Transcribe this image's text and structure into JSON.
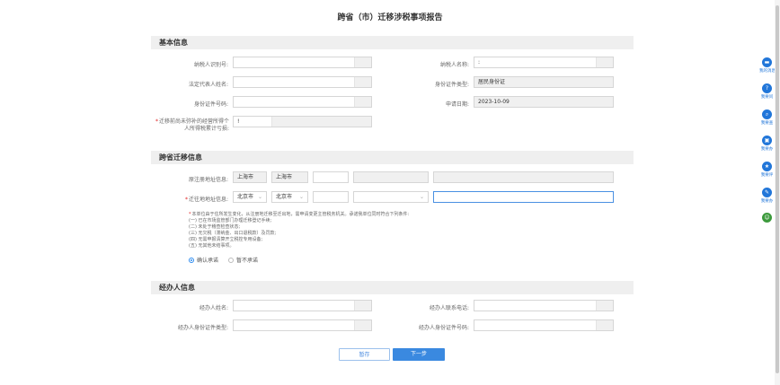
{
  "page_title": "跨省（市）迁移涉税事项报告",
  "sections": {
    "basic": "基本信息",
    "migration": "跨省迁移信息",
    "handler": "经办人信息"
  },
  "basic": {
    "taxpayer_id_label": "纳税人识别号:",
    "taxpayer_id_value": "",
    "taxpayer_name_label": "纳税人名称:",
    "taxpayer_name_value": ":",
    "legal_rep_label": "法定代表人姓名:",
    "legal_rep_value": "",
    "id_type_label": "身份证件类型:",
    "id_type_value": "居民身份证",
    "id_no_label": "身份证件号码:",
    "id_no_value": "",
    "apply_date_label": "申请日期:",
    "apply_date_value": "2023-10-09",
    "income_label_1": "迁移前尚未弥补的经营所得个",
    "income_label_2": "人所得税累计亏损:",
    "income_value": "!"
  },
  "migration": {
    "orig_label": "原注册地址信息:",
    "orig_province": "上海市",
    "orig_city": "上海市",
    "orig_district": "",
    "orig_street": "",
    "orig_detail": "",
    "new_label": "迁往地地址信息:",
    "new_province": "北京市",
    "new_city": "北京市",
    "new_district": "",
    "new_street": "",
    "new_detail": "",
    "notice": [
      "本单位由于住所发生变化，从注册地迁移至迁出地，需申请变更主管税务机关。承诺我单位同时符合下列条件:",
      "(一) 已在市场监管部门办理迁移登记手续;",
      "(二) 未处于稽查检查状态;",
      "(三) 无欠税（滞纳金、出口退税款）及罚款;",
      "(四) 无需申报清算开立税控专用设备;",
      "(五) 无其他未结事项。"
    ],
    "confirm_label": "确认承诺",
    "deny_label": "暂不承诺"
  },
  "handler": {
    "name_label": "经办人姓名:",
    "name_value": "",
    "phone_label": "经办人联系电话:",
    "phone_value": "",
    "id_type_label": "经办人身份证件类型:",
    "id_type_value": "",
    "id_no_label": "经办人身份证件号码:",
    "id_no_value": ""
  },
  "buttons": {
    "save": "暂存",
    "next": "下一步"
  },
  "sidebar": [
    {
      "label": "我的消息",
      "icon": "message-icon"
    },
    {
      "label": "我要问",
      "icon": "question-icon"
    },
    {
      "label": "我要查",
      "icon": "search-icon"
    },
    {
      "label": "我要办",
      "icon": "task-icon"
    },
    {
      "label": "我要评",
      "icon": "rating-icon"
    },
    {
      "label": "我要办",
      "icon": "pen-icon"
    }
  ],
  "colors": {
    "accent": "#3a89e0",
    "required": "#e02020",
    "section_bg": "#efefef"
  }
}
